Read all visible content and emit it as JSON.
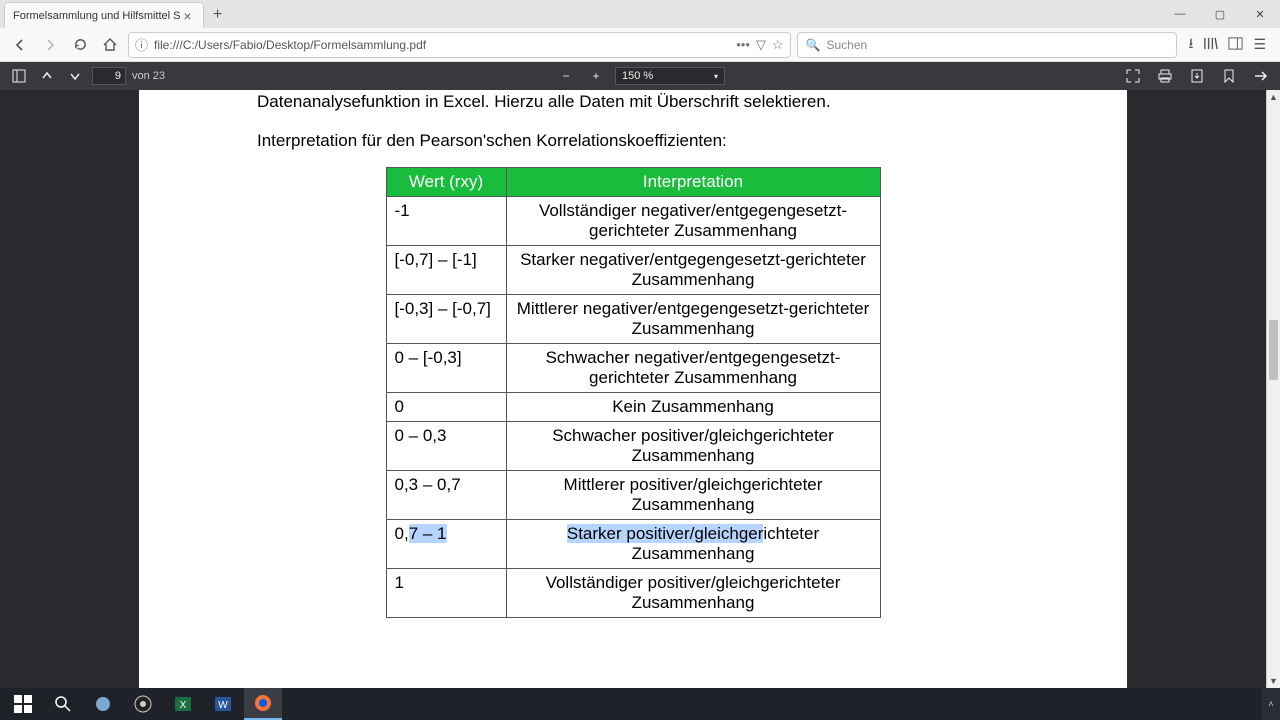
{
  "tab": {
    "title": "Formelsammlung und Hilfsmittel S"
  },
  "url": {
    "value": "file:///C:/Users/Fabio/Desktop/Formelsammlung.pdf"
  },
  "search": {
    "placeholder": "Suchen"
  },
  "pdf": {
    "page_current": "9",
    "page_of": "von 23",
    "zoom": "150 %"
  },
  "document": {
    "para1": "Datenanalysefunktion in Excel. Hierzu alle Daten mit Überschrift selektieren.",
    "para2": "Interpretation für den Pearson'schen Korrelationskoeffizienten:",
    "table": {
      "head_value": "Wert (rxy)",
      "head_interp": "Interpretation",
      "rows": [
        {
          "v": "-1",
          "i": "Vollständiger negativer/entgegengesetzt-gerichteter Zusammenhang"
        },
        {
          "v": "[-0,7] – [-1]",
          "i": "Starker negativer/entgegengesetzt-gerichteter Zusammenhang"
        },
        {
          "v": "[-0,3] – [-0,7]",
          "i": "Mittlerer negativer/entgegengesetzt-gerichteter Zusammenhang"
        },
        {
          "v": "0 – [-0,3]",
          "i": "Schwacher negativer/entgegengesetzt-gerichteter Zusammenhang"
        },
        {
          "v": "0",
          "i": "Kein Zusammenhang"
        },
        {
          "v": "0 – 0,3",
          "i": "Schwacher positiver/gleichgerichteter Zusammenhang"
        },
        {
          "v": "0,3 – 0,7",
          "i": "Mittlerer positiver/gleichgerichteter Zusammenhang"
        },
        {
          "v": "0,7 – 1",
          "i": "Starker positiver/gleichgerichteter Zusammenhang"
        },
        {
          "v": "1",
          "i": "Vollständiger positiver/gleichgerichteter Zusammenhang"
        }
      ]
    }
  }
}
